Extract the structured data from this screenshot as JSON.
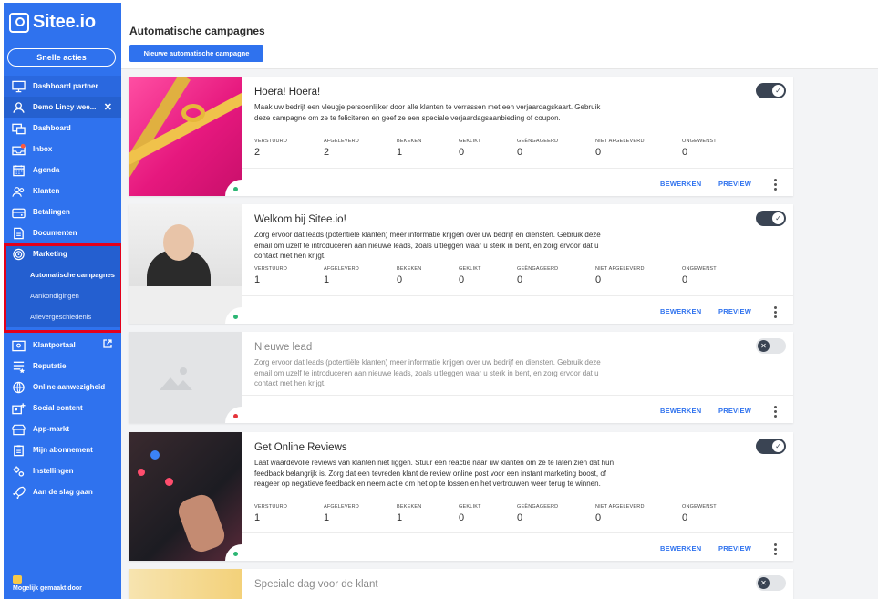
{
  "brand": {
    "name": "Sitee.io"
  },
  "quick_actions_label": "Snelle acties",
  "nav": {
    "partner": "Dashboard partner",
    "account": "Demo Lincy wee...",
    "items": [
      {
        "label": "Dashboard",
        "icon": "dashboard-icon"
      },
      {
        "label": "Inbox",
        "icon": "inbox-icon"
      },
      {
        "label": "Agenda",
        "icon": "calendar-icon"
      },
      {
        "label": "Klanten",
        "icon": "users-icon"
      },
      {
        "label": "Betalingen",
        "icon": "wallet-icon"
      },
      {
        "label": "Documenten",
        "icon": "document-icon"
      },
      {
        "label": "Marketing",
        "icon": "target-icon"
      }
    ],
    "marketing_sub": [
      "Automatische campagnes",
      "Aankondigingen",
      "Aflevergeschiedenis"
    ],
    "lower": [
      {
        "label": "Klantportaal",
        "icon": "portal-icon"
      },
      {
        "label": "Reputatie",
        "icon": "reputation-icon"
      },
      {
        "label": "Online aanwezigheid",
        "icon": "globe-icon"
      },
      {
        "label": "Social content",
        "icon": "social-icon"
      },
      {
        "label": "App-markt",
        "icon": "store-icon"
      },
      {
        "label": "Mijn abonnement",
        "icon": "clipboard-icon"
      },
      {
        "label": "Instellingen",
        "icon": "settings-icon"
      },
      {
        "label": "Aan de slag gaan",
        "icon": "rocket-icon"
      }
    ],
    "footer": "Mogelijk gemaakt door"
  },
  "header": {
    "title": "Automatische campagnes",
    "new_button": "Nieuwe automatische campagne"
  },
  "stat_labels": [
    "VERSTUURD",
    "AFGELEVERD",
    "BEKEKEN",
    "GEKLIKT",
    "GEËNGAGEERD",
    "NIET AFGELEVERD",
    "ONGEWENST"
  ],
  "actions": {
    "edit": "BEWERKEN",
    "preview": "PREVIEW"
  },
  "campaigns": [
    {
      "title": "Hoera! Hoera!",
      "desc": "Maak uw bedrijf een vleugje persoonlijker door alle klanten te verrassen met een verjaardagskaart. Gebruik deze campagne om ze te feliciteren en geef ze een speciale verjaardagsaanbieding of coupon.",
      "stats": [
        "2",
        "2",
        "1",
        "0",
        "0",
        "0",
        "0"
      ],
      "enabled": true
    },
    {
      "title": "Welkom bij Sitee.io!",
      "desc": "Zorg ervoor dat leads (potentiële klanten) meer informatie krijgen over uw bedrijf en diensten. Gebruik deze email om uzelf te introduceren aan nieuwe leads, zoals uitleggen waar u sterk in bent, en zorg ervoor dat u contact met hen krijgt.",
      "stats": [
        "1",
        "1",
        "0",
        "0",
        "0",
        "0",
        "0"
      ],
      "enabled": true
    },
    {
      "title": "Nieuwe lead",
      "desc": "Zorg ervoor dat leads (potentiële klanten) meer informatie krijgen over uw bedrijf en diensten. Gebruik deze email om uzelf te introduceren aan nieuwe leads, zoals uitleggen waar u sterk in bent, en zorg ervoor dat u contact met hen krijgt.",
      "enabled": false
    },
    {
      "title": "Get Online Reviews",
      "desc": "Laat waardevolle reviews van klanten niet liggen. Stuur een reactie naar uw klanten om ze te laten zien dat hun feedback belangrijk is. Zorg dat een tevreden klant de review online post voor een instant marketing boost, of reageer op negatieve feedback en neem actie om het op te lossen en het vertrouwen weer terug te winnen.",
      "stats": [
        "1",
        "1",
        "1",
        "0",
        "0",
        "0",
        "0"
      ],
      "enabled": true
    },
    {
      "title": "Speciale dag voor de klant",
      "enabled": false
    }
  ],
  "colors": {
    "sidebar": "#2f72ee",
    "accent": "#2f72ee",
    "highlight": "#e3001b",
    "toggle_on": "#3a4453"
  }
}
